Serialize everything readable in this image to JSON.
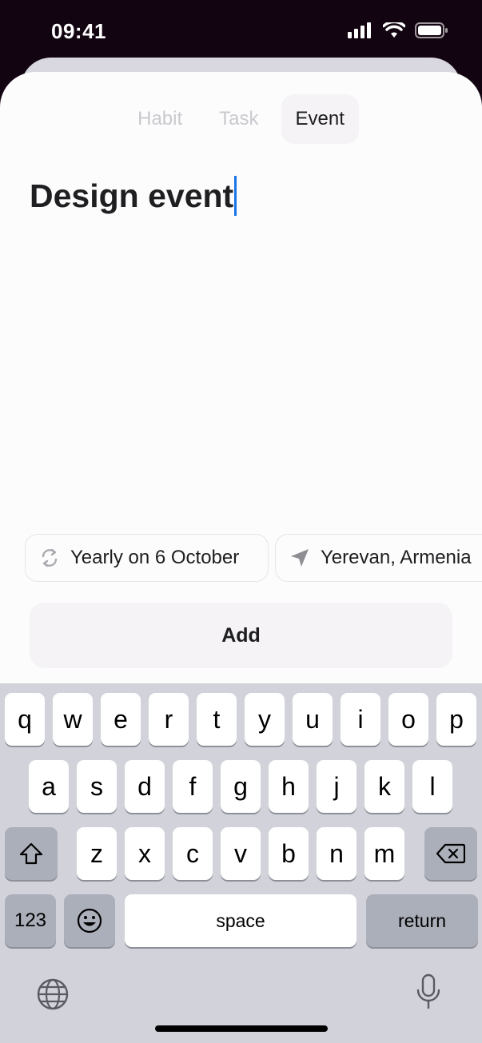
{
  "status": {
    "time": "09:41"
  },
  "tabs": [
    {
      "label": "Habit"
    },
    {
      "label": "Task"
    },
    {
      "label": "Event",
      "active": true
    }
  ],
  "title_input": {
    "value": "Design event"
  },
  "chips": [
    {
      "label": "Yearly on 6 October",
      "icon": "repeat-icon"
    },
    {
      "label": "Yerevan, Armenia",
      "icon": "location-arrow-icon"
    }
  ],
  "add_button": {
    "label": "Add"
  },
  "keyboard": {
    "row1": [
      "q",
      "w",
      "e",
      "r",
      "t",
      "y",
      "u",
      "i",
      "o",
      "p"
    ],
    "row2": [
      "a",
      "s",
      "d",
      "f",
      "g",
      "h",
      "j",
      "k",
      "l"
    ],
    "row3": [
      "z",
      "x",
      "c",
      "v",
      "b",
      "n",
      "m"
    ],
    "numbers_label": "123",
    "space_label": "space",
    "return_label": "return"
  },
  "colors": {
    "caret": "#1a73e8",
    "keyboard_bg": "#d2d3da"
  }
}
